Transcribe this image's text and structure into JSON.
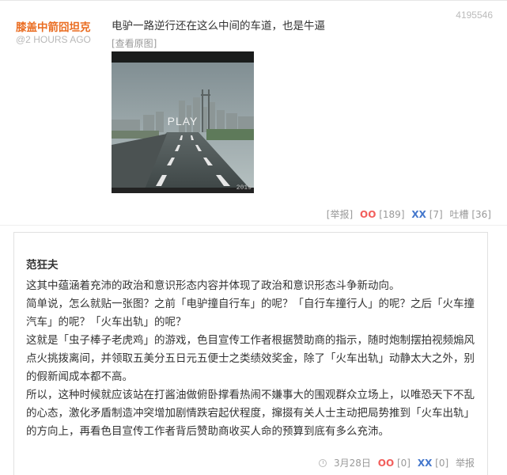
{
  "post": {
    "id": "4195546",
    "author": "膝盖中箭囧坦克",
    "time": "@2 HOURS AGO",
    "text": "电驴一路逆行还在这么中间的车道，也是牛逼",
    "view_original": "[查看原图]",
    "play_label": "PLAY",
    "image_stamp": "2019",
    "actions": {
      "report": "[举报]",
      "oo_label": "OO",
      "oo_count": "[189]",
      "xx_label": "XX",
      "xx_count": "[7]",
      "tucao_label": "吐槽",
      "tucao_count": "[36]"
    }
  },
  "reply": {
    "author": "范狂夫",
    "paragraphs": [
      "这其中蕴涵着充沛的政治和意识形态内容并体现了政治和意识形态斗争新动向。",
      "简单说，怎么就贴一张图？之前「电驴撞自行车」的呢？「自行车撞行人」的呢？之后「火车撞汽车」的呢？「火车出轨」的呢？",
      "这就是「虫子棒子老虎鸡」的游戏，色目宣传工作者根据赞助商的指示，随时炮制摆拍视频煽风点火挑拨离间，并领取五美分五日元五便士之类绩效奖金，除了「火车出轨」动静太大之外，别的假新闻成本都不高。",
      "所以，这种时候就应该站在打酱油做俯卧撑看热闹不嫌事大的围观群众立场上，以唯恐天下不乱的心态，激化矛盾制造冲突增加剧情跌宕起伏程度，撺掇有关人士主动把局势推到「火车出轨」的方向上，再看色目宣传工作者背后赞助商收买人命的预算到底有多么充沛。"
    ],
    "footer": {
      "date": "3月28日",
      "oo_label": "OO",
      "oo_count": "[0]",
      "xx_label": "XX",
      "xx_count": "[0]",
      "report": "举报"
    }
  },
  "colors": {
    "author": "#ea6d22",
    "oo": "#f25f5c",
    "xx": "#4477cc",
    "muted": "#999999"
  }
}
